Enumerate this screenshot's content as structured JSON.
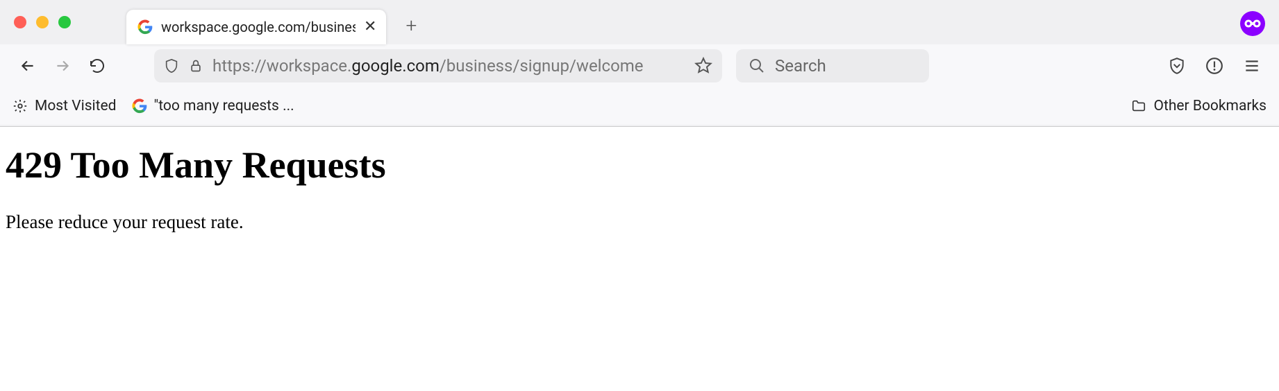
{
  "tab": {
    "title": "workspace.google.com/business"
  },
  "url": {
    "protocol": "https://",
    "pre_host": "workspace.",
    "host_strong": "google.com",
    "path": "/business/signup/welcome"
  },
  "search": {
    "placeholder": "Search"
  },
  "bookmarks": {
    "most_visited": "Most Visited",
    "item1": "\"too many requests ...",
    "other": "Other Bookmarks"
  },
  "page": {
    "heading": "429 Too Many Requests",
    "body": "Please reduce your request rate."
  }
}
